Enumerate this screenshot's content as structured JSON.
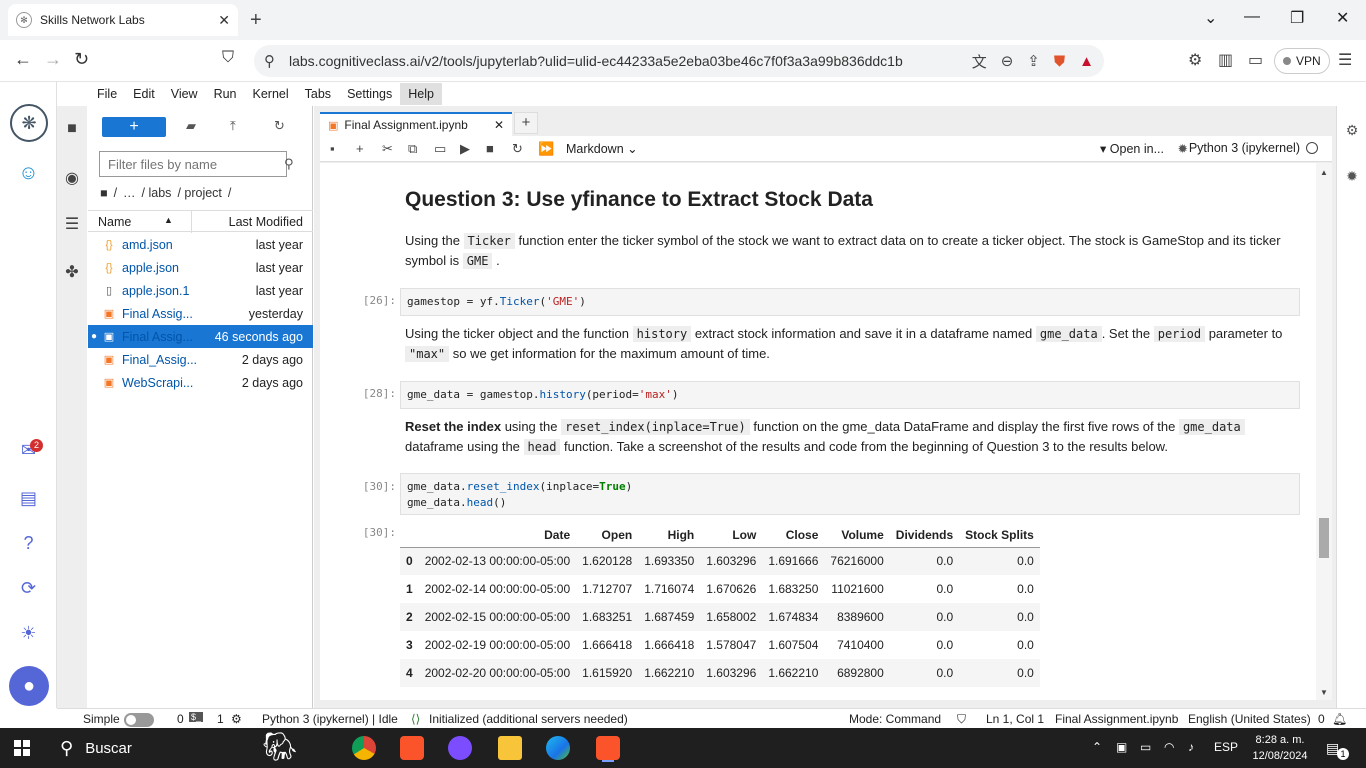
{
  "browser": {
    "tab_title": "Skills Network Labs",
    "url": "labs.cognitiveclass.ai/v2/tools/jupyterlab?ulid=ulid-ec44233a5e2eba03be46c7f0f3a3a99b836ddc1b",
    "vpn_label": "VPN"
  },
  "menu": [
    "File",
    "Edit",
    "View",
    "Run",
    "Kernel",
    "Tabs",
    "Settings",
    "Help"
  ],
  "activity": {
    "notification_count": "2"
  },
  "filebrowser": {
    "filter_placeholder": "Filter files by name",
    "breadcrumb": [
      "/",
      "…",
      "/ labs",
      "/ project",
      "/"
    ],
    "col_name": "Name",
    "col_modified": "Last Modified",
    "files": [
      {
        "icon": "{}",
        "name": "amd.json",
        "modified": "last year"
      },
      {
        "icon": "{}",
        "name": "apple.json",
        "modified": "last year"
      },
      {
        "icon": "▯",
        "name": "apple.json.1",
        "modified": "last year"
      },
      {
        "icon": "▣",
        "name": "Final Assig...",
        "modified": "yesterday"
      },
      {
        "icon": "▣",
        "name": "Final Assig...",
        "modified": "46 seconds ago"
      },
      {
        "icon": "▣",
        "name": "Final_Assig...",
        "modified": "2 days ago"
      },
      {
        "icon": "▣",
        "name": "WebScrapi...",
        "modified": "2 days ago"
      }
    ]
  },
  "notebook": {
    "tab_title": "Final Assignment.ipynb",
    "cell_type": "Markdown",
    "open_in": "Open in...",
    "kernel": "Python 3 (ipykernel)",
    "heading": "Question 3: Use yfinance to Extract Stock Data",
    "md1_a": "Using the ",
    "md1_code1": "Ticker",
    "md1_b": " function enter the ticker symbol of the stock we want to extract data on to create a ticker object. The stock is GameStop and its ticker symbol is ",
    "md1_code2": "GME",
    "md1_c": " .",
    "prompt1": "[26]:",
    "code1_a": "gamestop = yf.",
    "code1_fn": "Ticker",
    "code1_b": "(",
    "code1_str": "'GME'",
    "code1_c": ")",
    "md2_a": "Using the ticker object and the function ",
    "md2_code1": "history",
    "md2_b": " extract stock information and save it in a dataframe named ",
    "md2_code2": "gme_data",
    "md2_c": ". Set the ",
    "md2_code3": "period",
    "md2_d": " parameter to ",
    "md2_code4": "\"max\"",
    "md2_e": " so we get information for the maximum amount of time.",
    "prompt2": "[28]:",
    "code2_a": "gme_data = gamestop.",
    "code2_fn": "history",
    "code2_b": "(period=",
    "code2_str": "'max'",
    "code2_c": ")",
    "md3_bold": "Reset the index",
    "md3_a": " using the ",
    "md3_code1": "reset_index(inplace=True)",
    "md3_b": " function on the gme_data DataFrame and display the first five rows of the ",
    "md3_code2": "gme_data",
    "md3_c": " dataframe using the ",
    "md3_code3": "head",
    "md3_d": " function. Take a screenshot of the results and code from the beginning of Question 3 to the results below.",
    "prompt3": "[30]:",
    "code3_l1a": "gme_data.",
    "code3_l1fn": "reset_index",
    "code3_l1b": "(inplace=",
    "code3_l1kw": "True",
    "code3_l1c": ")",
    "code3_l2a": "gme_data.",
    "code3_l2fn": "head",
    "code3_l2b": "()",
    "prompt_out": "[30]:",
    "table": {
      "columns": [
        "",
        "Date",
        "Open",
        "High",
        "Low",
        "Close",
        "Volume",
        "Dividends",
        "Stock Splits"
      ],
      "rows": [
        [
          "0",
          "2002-02-13 00:00:00-05:00",
          "1.620128",
          "1.693350",
          "1.603296",
          "1.691666",
          "76216000",
          "0.0",
          "0.0"
        ],
        [
          "1",
          "2002-02-14 00:00:00-05:00",
          "1.712707",
          "1.716074",
          "1.670626",
          "1.683250",
          "11021600",
          "0.0",
          "0.0"
        ],
        [
          "2",
          "2002-02-15 00:00:00-05:00",
          "1.683251",
          "1.687459",
          "1.658002",
          "1.674834",
          "8389600",
          "0.0",
          "0.0"
        ],
        [
          "3",
          "2002-02-19 00:00:00-05:00",
          "1.666418",
          "1.666418",
          "1.578047",
          "1.607504",
          "7410400",
          "0.0",
          "0.0"
        ],
        [
          "4",
          "2002-02-20 00:00:00-05:00",
          "1.615920",
          "1.662210",
          "1.603296",
          "1.662210",
          "6892800",
          "0.0",
          "0.0"
        ]
      ]
    }
  },
  "status": {
    "mode": "Simple",
    "terminals": "0",
    "kernels": "1",
    "kernel_status": "Python 3 (ipykernel) | Idle",
    "lsp": "Initialized (additional servers needed)",
    "cmd_mode": "Mode: Command",
    "position": "Ln 1, Col 1",
    "filename": "Final Assignment.ipynb",
    "language": "English (United States)",
    "notif": "0"
  },
  "taskbar": {
    "search_label": "Buscar",
    "lang": "ESP",
    "time": "8:28 a. m.",
    "date": "12/08/2024",
    "notif": "1"
  }
}
